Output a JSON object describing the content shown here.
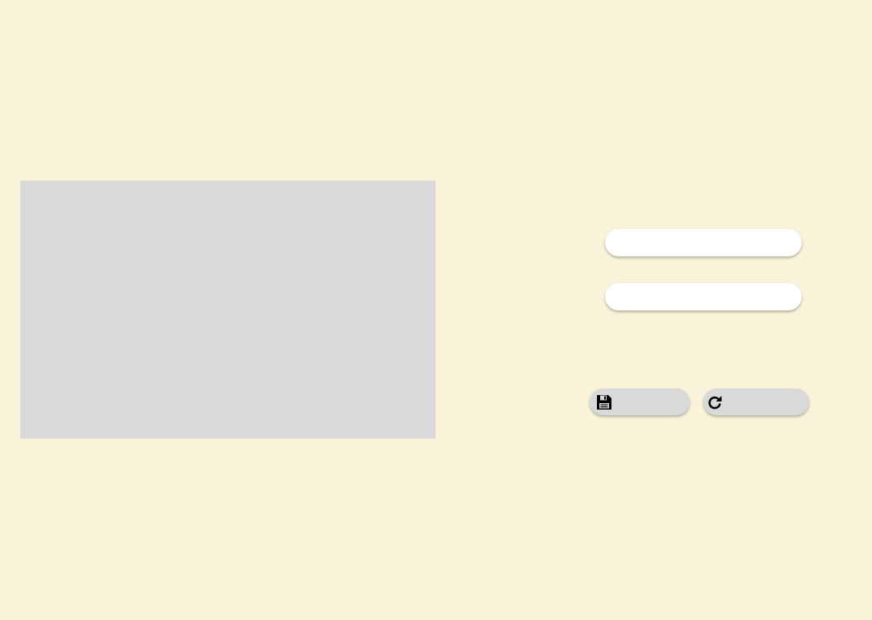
{
  "preview": {
    "background_color": "#d9d9d9"
  },
  "form": {
    "field_1": {
      "value": "",
      "placeholder": ""
    },
    "field_2": {
      "value": "",
      "placeholder": ""
    }
  },
  "actions": {
    "save": {
      "icon": "floppy-disk-icon",
      "label": ""
    },
    "redo": {
      "icon": "redo-arrow-icon",
      "label": ""
    }
  },
  "colors": {
    "page_background": "#f9f3d9",
    "field_background": "#ffffff",
    "button_background": "#d9d9d9"
  }
}
